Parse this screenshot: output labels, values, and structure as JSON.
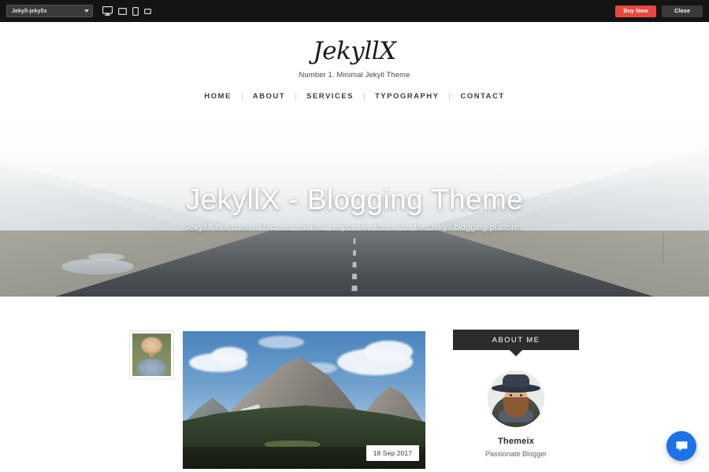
{
  "preview_bar": {
    "theme_selector": {
      "value": "Jekyll-jekyllx",
      "caret_icon": "chevron-down-icon"
    },
    "devices": [
      {
        "name": "desktop-preview-icon",
        "label": "Desktop"
      },
      {
        "name": "laptop-preview-icon",
        "label": "Laptop"
      },
      {
        "name": "tablet-preview-icon",
        "label": "Tablet"
      },
      {
        "name": "mobile-preview-icon",
        "label": "Mobile"
      }
    ],
    "buy_label": "Buy Now",
    "close_label": "Close",
    "buy_color": "#e8473f",
    "close_color": "#3a3a3a",
    "background": "#141414"
  },
  "site_header": {
    "logo": "JekyllX",
    "tagline": "Number 1. Minimal Jekyll Theme",
    "nav": [
      {
        "label": "HOME"
      },
      {
        "label": "ABOUT"
      },
      {
        "label": "SERVICES"
      },
      {
        "label": "TYPOGRAPHY"
      },
      {
        "label": "CONTACT"
      }
    ]
  },
  "hero": {
    "title": "JekyllX - Blogging Theme",
    "subtitle": "JekyllX is a content focused minimal responsive theme for the Jekyll blogging platform.",
    "image_description": "misty mountain valley with a road receding into fog"
  },
  "post": {
    "thumbnail_alt": "smiling bald man in grey jacket",
    "featured_image_alt": "rocky mountain peak under blue sky with clouds and forest below",
    "date": "18 Sep 2017"
  },
  "sidebar": {
    "widget_title": "ABOUT ME",
    "widget_background": "#2c2c2c",
    "author_avatar_alt": "bearded man wearing a wide brim hat",
    "author_name": "Themeix",
    "author_role": "Passionate Blogger"
  },
  "chat": {
    "icon": "chat-bubble-icon",
    "color": "#1a73e8"
  }
}
